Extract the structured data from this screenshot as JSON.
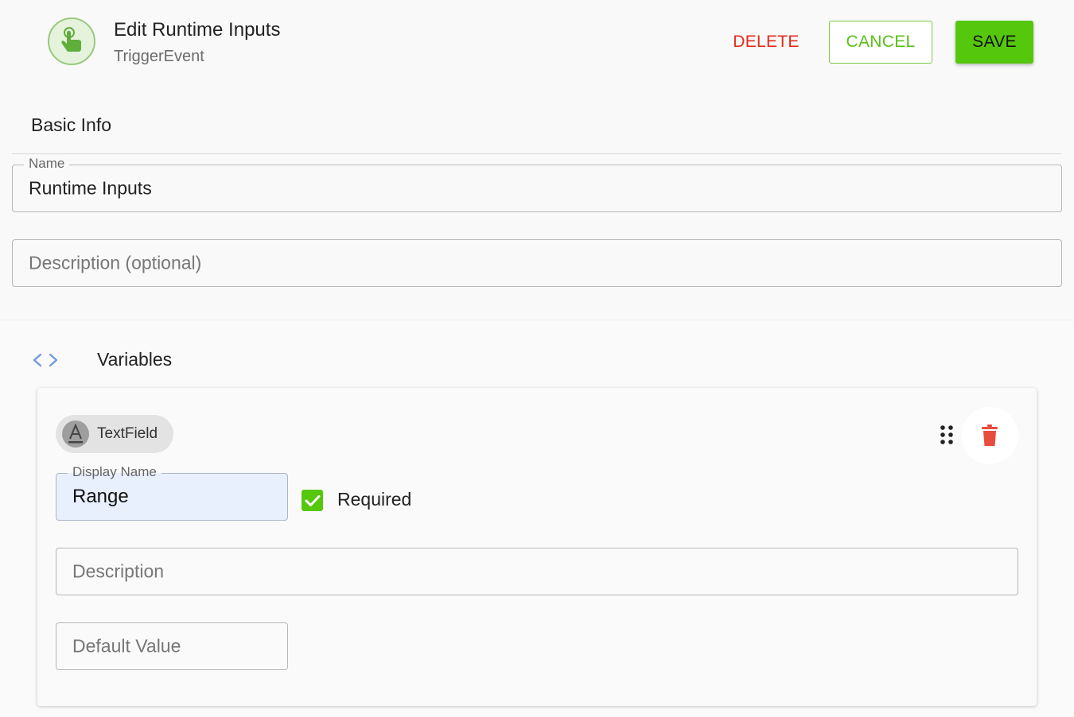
{
  "header": {
    "title": "Edit Runtime Inputs",
    "subtitle": "TriggerEvent",
    "icon": "touch-icon",
    "delete_label": "DELETE",
    "cancel_label": "CANCEL",
    "save_label": "SAVE"
  },
  "basic_info": {
    "title": "Basic Info",
    "name": {
      "label": "Name",
      "value": "Runtime Inputs"
    },
    "description": {
      "placeholder": "Description (optional)"
    }
  },
  "variables": {
    "title": "Variables",
    "items": [
      {
        "type_chip": {
          "letter": "A",
          "label": "TextField"
        },
        "display_name": {
          "label": "Display Name",
          "value": "Range"
        },
        "required": {
          "checked": true,
          "label": "Required"
        },
        "description": {
          "placeholder": "Description"
        },
        "default_value": {
          "placeholder": "Default Value"
        }
      }
    ]
  },
  "colors": {
    "accent_green": "#55c70d",
    "delete_red": "#e52b1f",
    "trash_red": "#e84c3d",
    "icon_bg": "#e5f3dc"
  }
}
